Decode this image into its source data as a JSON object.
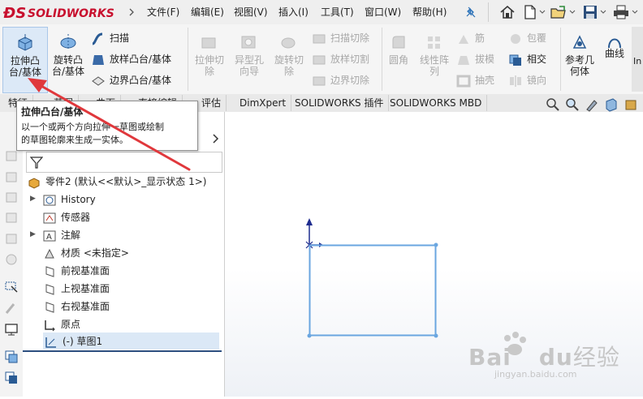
{
  "app": {
    "logo_text": "SOLIDWORKS"
  },
  "menu": [
    "文件(F)",
    "编辑(E)",
    "视图(V)",
    "插入(I)",
    "工具(T)",
    "窗口(W)",
    "帮助(H)"
  ],
  "ribbon": {
    "extrude_boss": [
      "拉伸凸",
      "台/基体"
    ],
    "revolve_boss": [
      "旋转凸",
      "台/基体"
    ],
    "sweep": "扫描",
    "loft_boss": "放样凸台/基体",
    "boundary_boss": "边界凸台/基体",
    "extrude_cut": [
      "拉伸切",
      "除"
    ],
    "hole_wizard": [
      "异型孔",
      "向导"
    ],
    "revolve_cut": [
      "旋转切",
      "除"
    ],
    "swept_cut": "扫描切除",
    "lofted_cut": "放样切割",
    "boundary_cut": "边界切除",
    "fillet": "圆角",
    "linear_pattern": [
      "线性阵",
      "列"
    ],
    "rib": "筋",
    "draft": "拔模",
    "shell": "抽壳",
    "wrap": "包覆",
    "intersect": "相交",
    "mirror": "镜向",
    "ref_geometry": [
      "参考几",
      "何体"
    ],
    "curves": "曲线",
    "instant3d": "In"
  },
  "tabs": [
    "特征",
    "草图",
    "曲面",
    "直接编辑",
    "评估",
    "DimXpert",
    "SOLIDWORKS 插件",
    "SOLIDWORKS MBD"
  ],
  "tooltip": {
    "title": "拉伸凸台/基体",
    "line1": "以一个或两个方向拉伸一草图或绘制",
    "line2": "的草图轮廓来生成一实体。"
  },
  "tree": {
    "root": "零件2  (默认<<默认>_显示状态 1>)",
    "items": [
      "History",
      "传感器",
      "注解",
      "材质 <未指定>",
      "前视基准面",
      "上视基准面",
      "右视基准面",
      "原点",
      "(-) 草图1"
    ]
  },
  "watermark": {
    "brand_a": "Bai",
    "brand_b": "du",
    "brand_c": "经验",
    "url": "jingyan.baidu.com"
  },
  "colors": {
    "accent_red": "#c8102e",
    "sketch_blue": "#6aa6e0",
    "annotation_arrow": "#e0383c"
  }
}
